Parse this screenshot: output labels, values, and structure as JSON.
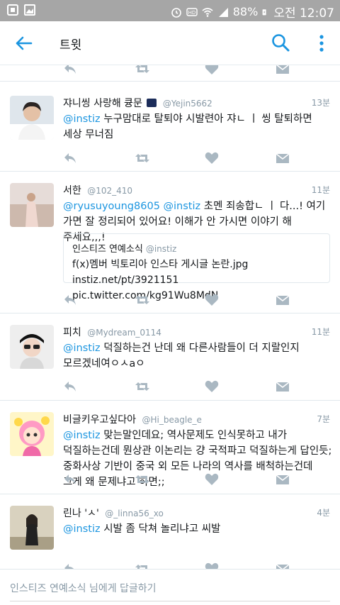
{
  "status_bar": {
    "battery": "88%",
    "time": "오전 12:07"
  },
  "header": {
    "title": "트윗"
  },
  "tweets": [
    {
      "name": "쟈니씽 사랑해 큥문",
      "handle": "@Yejin5662",
      "time": "13분",
      "mention": "@instiz",
      "text": " 누구맘대로 탈퇴야 시발련아 쟈ㄴ ㅣ 씽 탈퇴하면 세상 무너짐"
    },
    {
      "name": "서한",
      "handle": "@102_410",
      "time": "11분",
      "mention": "@ryusuyoung8605 @instiz",
      "text": " 초멘 죄송합ㄴ ㅣ 다...! 여기 가면 잘 정리되어 있어요! 이해가 안 가시면 이야기 해 주세요,,,!",
      "quote": {
        "name": "인스티즈 연예소식",
        "handle": "@instiz",
        "text": "f(x)멤버 빅토리아 인스타 게시글 논란.jpg instiz.net/pt/3921151 pic.twitter.com/kg91Wu8MdN"
      }
    },
    {
      "name": "피치",
      "handle": "@Mydream_0114",
      "time": "11분",
      "mention": "@instiz",
      "text": " 덕질하는건 난데 왜 다른사람들이 더 지랄인지 모르겠네여ㅇㅅaㅇ"
    },
    {
      "name": "비글키우고싶다아",
      "handle": "@Hi_beagle_e",
      "time": "7분",
      "mention": "@instiz",
      "text": " 맞는말인데요; 역사문제도 인식못하고 내가 덕질하는건데 뭔상관 이논리는 걍 국적파고 덕질하는게 답인듯; 중화사상 기반이 중국 외 모든 나라의 역사를 배척하는건데 그게 왜 문제냐고 하면;;"
    },
    {
      "name": "린나 'ㅅ'",
      "handle": "@_linna56_xo",
      "time": "4분",
      "mention": "@instiz",
      "text": " 시발 좀 닥쳐 놀리냐고 씨발"
    }
  ],
  "reply": {
    "placeholder": "인스티즈 연예소식 님에게 답글하기"
  },
  "colors": {
    "accent": "#1b95e0",
    "icon_gray": "#aab8c2",
    "status_bar": "#a6a6a6"
  }
}
